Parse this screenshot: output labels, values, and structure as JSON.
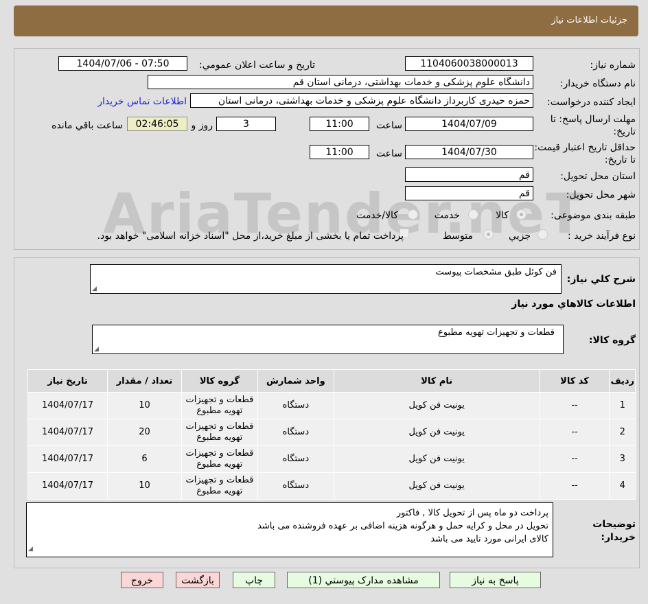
{
  "header": {
    "title": "جزئیات اطلاعات نیاز"
  },
  "form": {
    "need_number_label": "شماره نیاز:",
    "need_number": "1104060038000013",
    "announce_label": "تاریخ و ساعت اعلان عمومي:",
    "announce_value": "1404/07/06 - 07:50",
    "buyer_org_label": "نام دستگاه خریدار:",
    "buyer_org": "دانشگاه علوم پزشکی و خدمات بهداشتی، درمانی استان قم",
    "creator_label": "ایجاد کننده درخواست:",
    "creator": "حمزه حیدری کاربرداز دانشگاه علوم پزشکی و خدمات بهداشتی، درمانی استان",
    "contact_link": "اطلاعات تماس خریدار",
    "deadline_label": "مهلت ارسال پاسخ: تا تاریخ:",
    "deadline_date": "1404/07/09",
    "time_label": "ساعت",
    "deadline_time": "11:00",
    "days": "3",
    "days_label": "روز و",
    "remaining": "02:46:05",
    "remaining_label": "ساعت باقي مانده",
    "validity_label": "حداقل تاریخ اعتبار قیمت: تا تاریخ:",
    "validity_date": "1404/07/30",
    "validity_time": "11:00",
    "province_label": "استان محل تحویل:",
    "province": "قم",
    "city_label": "شهر محل تحویل:",
    "city": "قم",
    "category_label": "طبقه بندی موضوعی:",
    "category_options": [
      "کالا",
      "خدمت",
      "کالا/خدمت"
    ],
    "process_label": "نوع فرآیند خرید :",
    "process_options": [
      "جزيي",
      "متوسط"
    ],
    "payment_note": "پرداخت تمام یا بخشی از مبلغ خرید،از محل \"اسناد خزانه اسلامی\" خواهد بود."
  },
  "watermark": "AriaTender.neT",
  "details": {
    "summary_label": "شرح کلي نیاز:",
    "summary": "فن کوئل طبق مشخصات پیوست",
    "goods_info_title": "اطلاعات کالاهاي مورد نیاز",
    "group_label": "گروه کالا:",
    "group": "قطعات و تجهیزات تهویه مطبوع",
    "columns": [
      "ردیف",
      "کد کالا",
      "نام کالا",
      "واحد شمارش",
      "گروه کالا",
      "تعداد / مقدار",
      "تاریخ نیاز"
    ],
    "rows": [
      [
        "1",
        "--",
        "یونیت فن کویل",
        "دستگاه",
        "قطعات و تجهیزات تهویه مطبوع",
        "10",
        "1404/07/17"
      ],
      [
        "2",
        "--",
        "یونیت فن کویل",
        "دستگاه",
        "قطعات و تجهیزات تهویه مطبوع",
        "20",
        "1404/07/17"
      ],
      [
        "3",
        "--",
        "یونیت فن کویل",
        "دستگاه",
        "قطعات و تجهیزات تهویه مطبوع",
        "6",
        "1404/07/17"
      ],
      [
        "4",
        "--",
        "یونیت فن کویل",
        "دستگاه",
        "قطعات و تجهیزات تهویه مطبوع",
        "10",
        "1404/07/17"
      ]
    ],
    "notes_label": "توضیحات خریدار:",
    "notes": [
      "پرداخت دو ماه پس از تحویل کالا , فاکتور",
      "تحویل در محل و کرایه حمل و هرگونه هزینه اضافی بر عهده فروشنده می باشد",
      "کالای ایرانی مورد تایید می باشد"
    ]
  },
  "buttons": {
    "reply": "پاسخ به نیاز",
    "attachments": "مشاهده مدارک پیوستي (1)",
    "print": "چاپ",
    "back": "بازگشت",
    "exit": "خروج"
  }
}
